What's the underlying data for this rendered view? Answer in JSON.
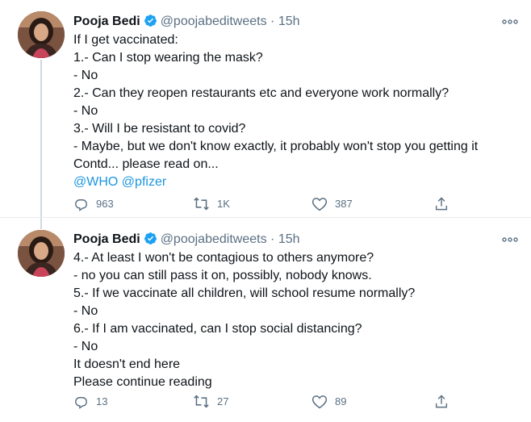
{
  "tweets": [
    {
      "author_name": "Pooja Bedi",
      "handle": "@poojabeditweets",
      "separator": "·",
      "time": "15h",
      "lines": [
        "If I get vaccinated:",
        "1.- Can I stop wearing the mask?",
        "- No",
        "2.- Can they reopen restaurants etc and everyone work normally?",
        "- No",
        "3.- Will I be resistant to covid?",
        "- Maybe, but we don't know exactly, it probably won't stop you getting it",
        "Contd... please read on..."
      ],
      "mentions": [
        "@WHO",
        "@pfizer"
      ],
      "reply_count": "963",
      "retweet_count": "1K",
      "like_count": "387"
    },
    {
      "author_name": "Pooja Bedi",
      "handle": "@poojabeditweets",
      "separator": "·",
      "time": "15h",
      "lines": [
        "4.- At least I won't be contagious to others anymore?",
        "- no you can still pass it on, possibly, nobody knows.",
        "5.- If we vaccinate all children, will school resume normally?",
        "- No",
        "6.- If I am vaccinated, can I stop social distancing?",
        "- No",
        "It doesn't end here",
        "Please continue reading"
      ],
      "reply_count": "13",
      "retweet_count": "27",
      "like_count": "89"
    }
  ],
  "icons": {
    "verified": "verified-badge-icon",
    "more": "more-options-icon",
    "reply": "reply-icon",
    "retweet": "retweet-icon",
    "like": "heart-icon",
    "share": "share-icon"
  },
  "colors": {
    "text": "#0f1419",
    "secondary": "#5b7083",
    "link": "#1b95e0",
    "verified": "#1da1f2",
    "divider": "#e6ecf0"
  }
}
